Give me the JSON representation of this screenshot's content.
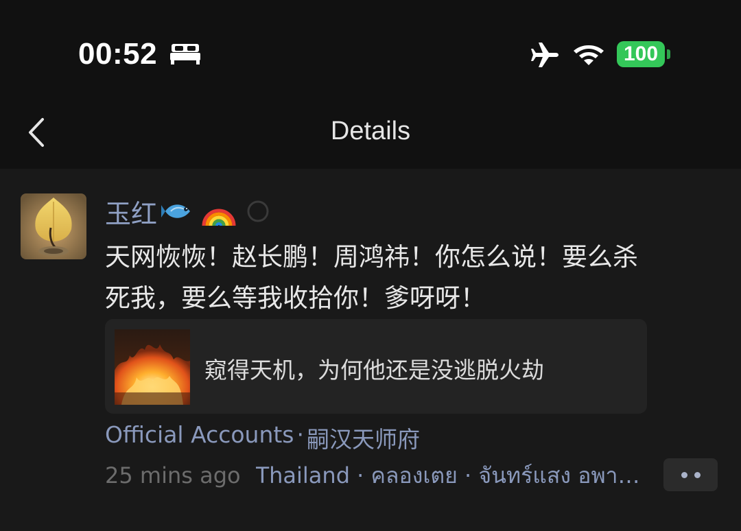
{
  "status_bar": {
    "time": "00:52",
    "battery": "100",
    "icons": [
      "sleep-icon",
      "airplane-icon",
      "wifi-icon",
      "battery-icon"
    ]
  },
  "nav": {
    "title": "Details",
    "back_icon": "chevron-left-icon"
  },
  "post": {
    "author": "玉红",
    "author_badges": [
      "fish-emoji",
      "rainbow-emoji",
      "loading-icon"
    ],
    "text": "天网恢恢！赵长鹏！周鸿祎！你怎么说！要么杀\n死我，要么等我收拾你！爹呀呀！",
    "link_card": {
      "title": "窥得天机，为何他还是没逃脱火劫",
      "thumbnail": "fire-image"
    },
    "source_label": "Official Accounts",
    "source_sep": "·",
    "source_name": "嗣汉天师府",
    "time_ago": "25 mins ago",
    "location": "Thailand · คลองเตย · จันทร์แสง อพาร์ทเมนท์",
    "more_icon": "more-dots-icon"
  },
  "colors": {
    "background": "#191919",
    "bar": "#111111",
    "link_blue": "#8a99bc",
    "battery_green": "#34c759"
  }
}
